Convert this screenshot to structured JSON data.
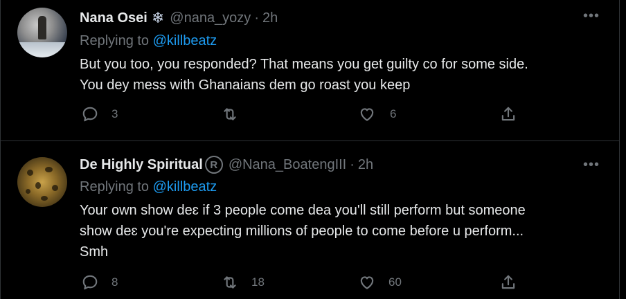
{
  "tweets": [
    {
      "name": "Nana Osei",
      "badge": "❄",
      "handle": "@nana_yozy",
      "time": "2h",
      "replying_label": "Replying to",
      "replying_to": "@killbeatz",
      "text_lines": [
        "But you too, you responded? That means you get guilty co for some side.",
        "You dey mess with Ghanaians dem go roast you keep"
      ],
      "replies": "3",
      "retweets": "",
      "likes": "6",
      "more": "•••"
    },
    {
      "name": "De Highly Spiritual",
      "badge": "R",
      "handle": "@Nana_BoatengIII",
      "time": "2h",
      "replying_label": "Replying to",
      "replying_to": "@killbeatz",
      "text_lines": [
        "Your own show deɛ if 3 people come dea you'll still perform but someone",
        "show deɛ you're expecting millions of people to come before u perform...",
        "Smh"
      ],
      "replies": "8",
      "retweets": "18",
      "likes": "60",
      "more": "•••"
    }
  ],
  "colors": {
    "background": "#000000",
    "text": "#e7e9ea",
    "secondary": "#71767b",
    "link": "#1d9bf0",
    "border": "#2f3336"
  },
  "icons": [
    "reply-icon",
    "retweet-icon",
    "like-icon",
    "share-icon",
    "more-icon",
    "snowflake-icon",
    "registered-icon"
  ]
}
